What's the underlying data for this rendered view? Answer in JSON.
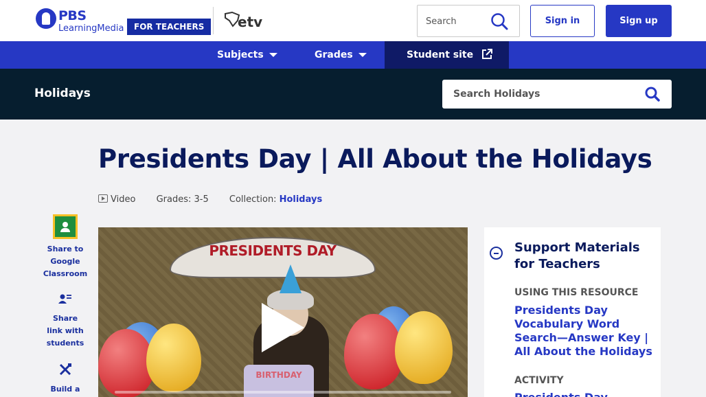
{
  "header": {
    "logo_brand": "PBS",
    "logo_sub": "LearningMedia",
    "for_teachers": "FOR TEACHERS",
    "partner_logo": "etv",
    "search_placeholder": "Search",
    "signin_label": "Sign in",
    "signup_label": "Sign up"
  },
  "nav": {
    "subjects": "Subjects",
    "grades": "Grades",
    "student_site": "Student site"
  },
  "collection": {
    "title": "Holidays",
    "search_placeholder": "Search Holidays"
  },
  "resource": {
    "title": "Presidents Day | All About the Holidays",
    "type": "Video",
    "grades": "Grades: 3-5",
    "collection_label": "Collection:",
    "collection_link": "Holidays"
  },
  "share": {
    "google_classroom": "Share to Google Classroom",
    "share_link": "Share link with students",
    "build": "Build a"
  },
  "video": {
    "banner_text": "PRESIDENTS DAY",
    "cake_text": "BIRTHDAY"
  },
  "support": {
    "title": "Support Materials for Teachers",
    "section1": "USING THIS RESOURCE",
    "link1": "Presidents Day Vocabulary Word Search—Answer Key | All About the Holidays",
    "section2": "ACTIVITY",
    "link2": "Presidents Day"
  },
  "colors": {
    "brand_blue": "#2638c4",
    "navy": "#0a1a5c",
    "band_dark": "#061e2f"
  }
}
